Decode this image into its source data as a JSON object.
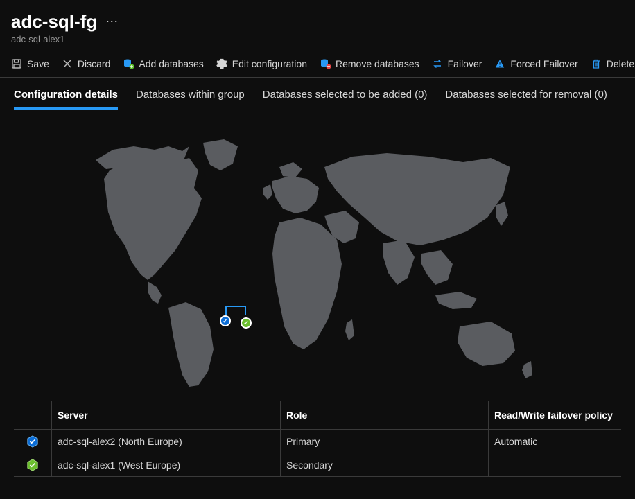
{
  "header": {
    "title": "adc-sql-fg",
    "subtitle": "adc-sql-alex1"
  },
  "toolbar": {
    "save_label": "Save",
    "discard_label": "Discard",
    "add_databases_label": "Add databases",
    "edit_configuration_label": "Edit configuration",
    "remove_databases_label": "Remove databases",
    "failover_label": "Failover",
    "forced_failover_label": "Forced Failover",
    "delete_label": "Delete"
  },
  "tabs": {
    "configuration_details": "Configuration details",
    "databases_within_group": "Databases within group",
    "databases_to_add": "Databases selected to be added (0)",
    "databases_to_remove": "Databases selected for removal (0)"
  },
  "table": {
    "columns": {
      "server": "Server",
      "role": "Role",
      "policy": "Read/Write failover policy"
    },
    "rows": [
      {
        "server": "adc-sql-alex2 (North Europe)",
        "role": "Primary",
        "policy": "Automatic",
        "icon": "primary"
      },
      {
        "server": "adc-sql-alex1 (West Europe)",
        "role": "Secondary",
        "policy": "",
        "icon": "secondary"
      }
    ]
  }
}
